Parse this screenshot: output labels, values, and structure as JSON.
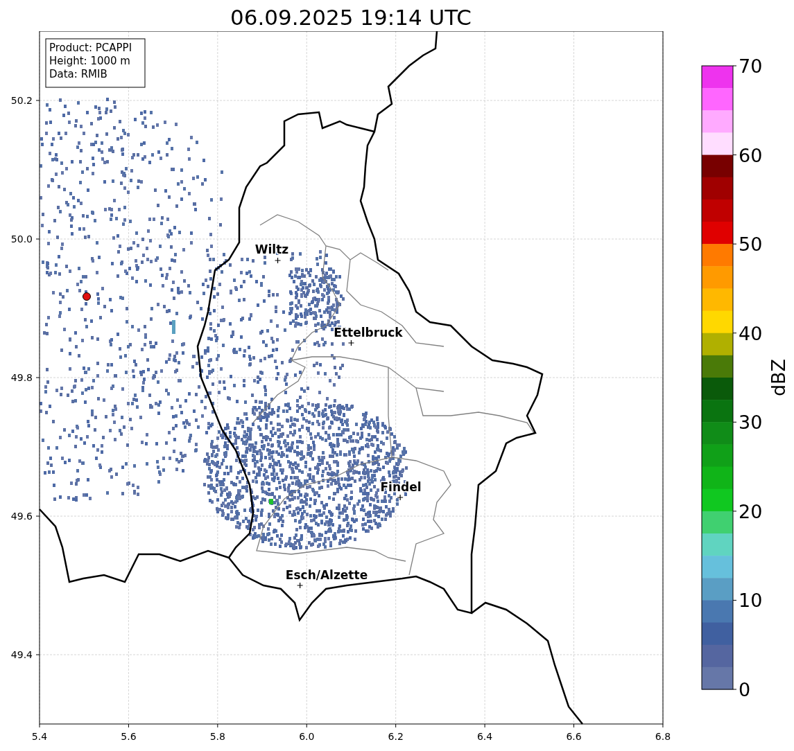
{
  "title": "06.09.2025 19:14 UTC",
  "info_box": [
    "Product: PCAPPI",
    "Height: 1000 m",
    "Data: RMIB"
  ],
  "map": {
    "places": [
      {
        "name": "Wiltz"
      },
      {
        "name": "Ettelbruck"
      },
      {
        "name": "Findel"
      },
      {
        "name": "Esch/Alzette"
      }
    ],
    "x_ticks": [
      "5.4",
      "5.6",
      "5.8",
      "6.0",
      "6.2",
      "6.4",
      "6.6",
      "6.8"
    ],
    "y_ticks": [
      "50.2",
      "50.0",
      "49.8",
      "49.6",
      "49.4"
    ]
  },
  "colorbar": {
    "label": "dBZ",
    "ticks": [
      "70",
      "60",
      "50",
      "40",
      "30",
      "20",
      "10",
      "0"
    ],
    "segments": [
      {
        "color": "#ee33ee"
      },
      {
        "color": "#ff66ff"
      },
      {
        "color": "#ffaaff"
      },
      {
        "color": "#ffddff"
      },
      {
        "color": "#780000"
      },
      {
        "color": "#a00000"
      },
      {
        "color": "#c00000"
      },
      {
        "color": "#e00000"
      },
      {
        "color": "#ff7a00"
      },
      {
        "color": "#ff9a00"
      },
      {
        "color": "#ffb800"
      },
      {
        "color": "#ffd800"
      },
      {
        "color": "#b0b000"
      },
      {
        "color": "#4a7a08"
      },
      {
        "color": "#0a5a0a"
      },
      {
        "color": "#0a7410"
      },
      {
        "color": "#108c18"
      },
      {
        "color": "#10a018"
      },
      {
        "color": "#10b418"
      },
      {
        "color": "#10c820"
      },
      {
        "color": "#40d070"
      },
      {
        "color": "#60d4c0"
      },
      {
        "color": "#66c0dc"
      },
      {
        "color": "#5a9ec4"
      },
      {
        "color": "#4a78b0"
      },
      {
        "color": "#4060a0"
      },
      {
        "color": "#5566a0"
      },
      {
        "color": "#6677a8"
      }
    ]
  }
}
